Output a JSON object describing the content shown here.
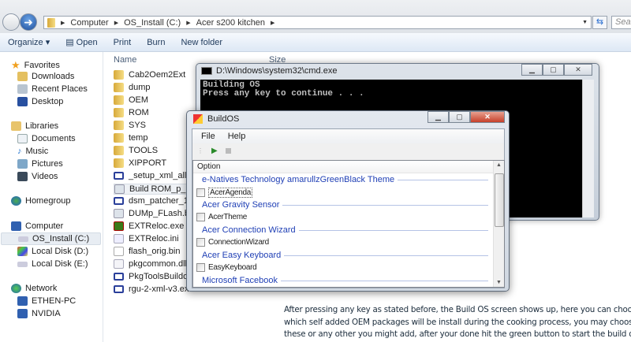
{
  "explorer": {
    "breadcrumb": [
      "Computer",
      "OS_Install (C:)",
      "Acer s200 kitchen"
    ],
    "search_placeholder": "Search",
    "toolbar": [
      "Organize ▾",
      "Open",
      "Print",
      "Burn",
      "New folder"
    ],
    "columns": {
      "name": "Name",
      "size": "Size"
    },
    "nav": {
      "favorites": {
        "label": "Favorites",
        "items": [
          "Downloads",
          "Recent Places",
          "Desktop"
        ]
      },
      "libraries": {
        "label": "Libraries",
        "items": [
          "Documents",
          "Music",
          "Pictures",
          "Videos"
        ]
      },
      "homegroup": "Homegroup",
      "computer": {
        "label": "Computer",
        "items": [
          "OS_Install (C:)",
          "Local Disk (D:)",
          "Local Disk (E:)"
        ]
      },
      "network": {
        "label": "Network",
        "items": [
          "ETHEN-PC",
          "NVIDIA"
        ]
      }
    },
    "files": [
      {
        "name": "Cab2Oem2Ext",
        "type": "folder"
      },
      {
        "name": "dump",
        "type": "folder"
      },
      {
        "name": "OEM",
        "type": "folder"
      },
      {
        "name": "ROM",
        "type": "folder"
      },
      {
        "name": "SYS",
        "type": "folder"
      },
      {
        "name": "temp",
        "type": "folder"
      },
      {
        "name": "TOOLS",
        "type": "folder"
      },
      {
        "name": "XIPPORT",
        "type": "folder"
      },
      {
        "name": "_setup_xml_alligner.exe",
        "type": "exe"
      },
      {
        "name": "Build ROM_p_6.5_os.bat",
        "type": "bat"
      },
      {
        "name": "dsm_patcher_1.6.exe",
        "type": "exe"
      },
      {
        "name": "DUMp_FLash.bint.bat",
        "type": "bat"
      },
      {
        "name": "EXTReloc.exe",
        "type": "er"
      },
      {
        "name": "EXTReloc.ini",
        "type": "ini"
      },
      {
        "name": "flash_orig.bin",
        "type": "file"
      },
      {
        "name": "pkgcommon.dll",
        "type": "dll"
      },
      {
        "name": "PkgToolsBuildos-4.2.exe",
        "type": "exe"
      },
      {
        "name": "rgu-2-xml-v3.exe",
        "type": "exe"
      }
    ]
  },
  "cmd": {
    "title": "D:\\Windows\\system32\\cmd.exe",
    "output": "Building OS\nPress any key to continue . . ."
  },
  "buildos": {
    "title": "BuildOS",
    "menu": [
      "File",
      "Help"
    ],
    "column": "Option",
    "groups": [
      {
        "label": "e-Natives Technology amarullzGreenBlack Theme",
        "option": "AcerAgenda"
      },
      {
        "label": "Acer Gravity Sensor",
        "option": "AcerTheme"
      },
      {
        "label": "Acer Connection Wizard",
        "option": "ConnectionWizard"
      },
      {
        "label": "Acer Easy Keyboard",
        "option": "EasyKeyboard"
      },
      {
        "label": "Microsoft Facebook",
        "option": null
      }
    ]
  },
  "caption": [
    "After pressing any key as stated before, the Build OS screen shows up, here you can choose",
    "which self added OEM packages will be install during the cooking process, you may choose",
    "these or any other you might add, after your done hit the green button to start the build os."
  ]
}
